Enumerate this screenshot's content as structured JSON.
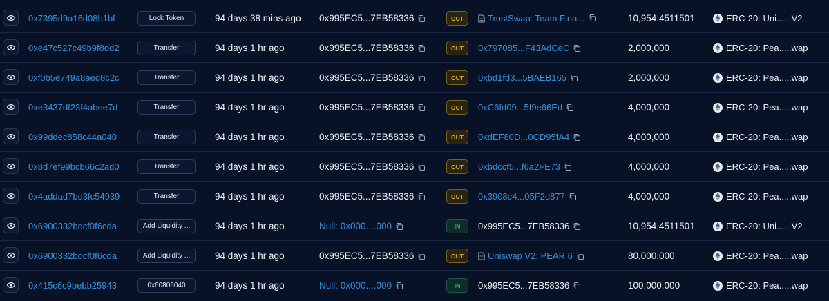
{
  "rows": [
    {
      "hash": "0x7395d9a16d08b1bf",
      "method": "Lock Token",
      "age": "94 days 38 mins ago",
      "from": "0x995EC5...7EB58336",
      "from_link": false,
      "dir": "OUT",
      "to": "TrustSwap: Team Fina...",
      "to_doc": true,
      "to_copy_box": true,
      "amount": "10,954.4511501",
      "token": "ERC-20: Uni..... V2"
    },
    {
      "hash": "0xe47c527c49b9f8dd2",
      "method": "Transfer",
      "age": "94 days 1 hr ago",
      "from": "0x995EC5...7EB58336",
      "from_link": false,
      "dir": "OUT",
      "to": "0x797085...F43AdCeC",
      "to_doc": false,
      "to_copy_box": false,
      "amount": "2,000,000",
      "token": "ERC-20: Pea.....wap"
    },
    {
      "hash": "0xf0b5e749a8aed8c2c",
      "method": "Transfer",
      "age": "94 days 1 hr ago",
      "from": "0x995EC5...7EB58336",
      "from_link": false,
      "dir": "OUT",
      "to": "0xbd1fd3...5BAEB165",
      "to_doc": false,
      "to_copy_box": false,
      "amount": "2,000,000",
      "token": "ERC-20: Pea.....wap"
    },
    {
      "hash": "0xe3437df23f4abee7d",
      "method": "Transfer",
      "age": "94 days 1 hr ago",
      "from": "0x995EC5...7EB58336",
      "from_link": false,
      "dir": "OUT",
      "to": "0xC6fd09...5f9e66Ed",
      "to_doc": false,
      "to_copy_box": false,
      "amount": "4,000,000",
      "token": "ERC-20: Pea.....wap"
    },
    {
      "hash": "0x99ddec858c44a040",
      "method": "Transfer",
      "age": "94 days 1 hr ago",
      "from": "0x995EC5...7EB58336",
      "from_link": false,
      "dir": "OUT",
      "to": "0xdEF80D...0CD95fA4",
      "to_doc": false,
      "to_copy_box": false,
      "amount": "4,000,000",
      "token": "ERC-20: Pea.....wap"
    },
    {
      "hash": "0x8d7ef99bcb66c2ad0",
      "method": "Transfer",
      "age": "94 days 1 hr ago",
      "from": "0x995EC5...7EB58336",
      "from_link": false,
      "dir": "OUT",
      "to": "0xbdccf5...f6a2FE73",
      "to_doc": false,
      "to_copy_box": false,
      "amount": "4,000,000",
      "token": "ERC-20: Pea.....wap"
    },
    {
      "hash": "0x4addad7bd3fc54939",
      "method": "Transfer",
      "age": "94 days 1 hr ago",
      "from": "0x995EC5...7EB58336",
      "from_link": false,
      "dir": "OUT",
      "to": "0x3908c4...05F2d877",
      "to_doc": false,
      "to_copy_box": false,
      "amount": "4,000,000",
      "token": "ERC-20: Pea.....wap"
    },
    {
      "hash": "0x6900332bdcf0f6cda",
      "method": "Add Liquidity ...",
      "age": "94 days 1 hr ago",
      "from": "Null: 0x000....000",
      "from_link": true,
      "dir": "IN",
      "to": "0x995EC5...7EB58336",
      "to_doc": false,
      "to_copy_box": false,
      "to_dark": true,
      "amount": "10,954.4511501",
      "token": "ERC-20: Uni..... V2"
    },
    {
      "hash": "0x6900332bdcf0f6cda",
      "method": "Add Liquidity ...",
      "age": "94 days 1 hr ago",
      "from": "0x995EC5...7EB58336",
      "from_link": false,
      "dir": "OUT",
      "to": "Uniswap V2: PEAR 6",
      "to_doc": true,
      "to_copy_box": false,
      "amount": "80,000,000",
      "token": "ERC-20: Pea.....wap"
    },
    {
      "hash": "0x415c6c9bebb25943",
      "method": "0x60806040",
      "age": "94 days 1 hr ago",
      "from": "Null: 0x000....000",
      "from_link": true,
      "dir": "IN",
      "to": "0x995EC5...7EB58336",
      "to_doc": false,
      "to_copy_box": false,
      "to_dark": true,
      "amount": "100,000,000",
      "token": "ERC-20: Pea.....wap"
    }
  ]
}
